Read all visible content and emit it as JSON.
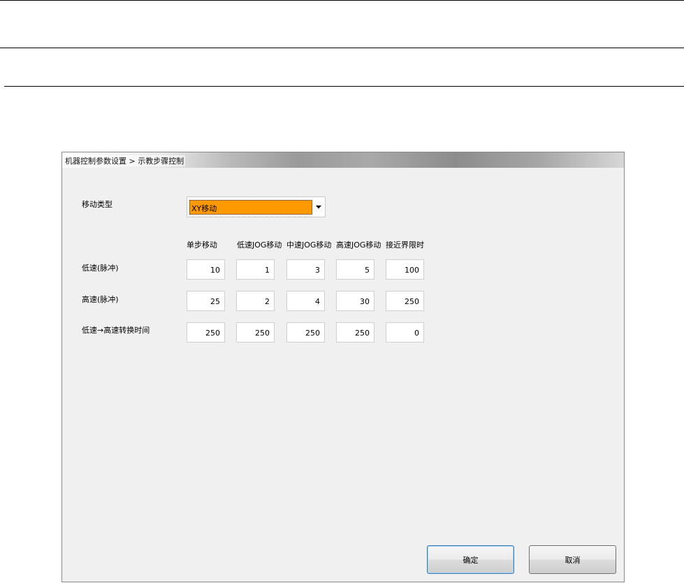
{
  "dialog": {
    "breadcrumb": "机器控制参数设置 > 示教步骤控制",
    "move_type": {
      "label": "移动类型",
      "selected": "XY移动"
    },
    "columns": [
      "单步移动",
      "低速JOG移动",
      "中速JOG移动",
      "高速JOG移动",
      "接近界限时"
    ],
    "rows": [
      {
        "label": "低速(脉冲)",
        "values": [
          "10",
          "1",
          "3",
          "5",
          "100"
        ]
      },
      {
        "label": "高速(脉冲)",
        "values": [
          "25",
          "2",
          "4",
          "30",
          "250"
        ]
      },
      {
        "label": "低速→高速转换时间",
        "values": [
          "250",
          "250",
          "250",
          "250",
          "0"
        ]
      }
    ],
    "buttons": {
      "ok": "确定",
      "cancel": "取消"
    }
  },
  "icons": {
    "dropdown": "dropdown-arrow-icon"
  }
}
